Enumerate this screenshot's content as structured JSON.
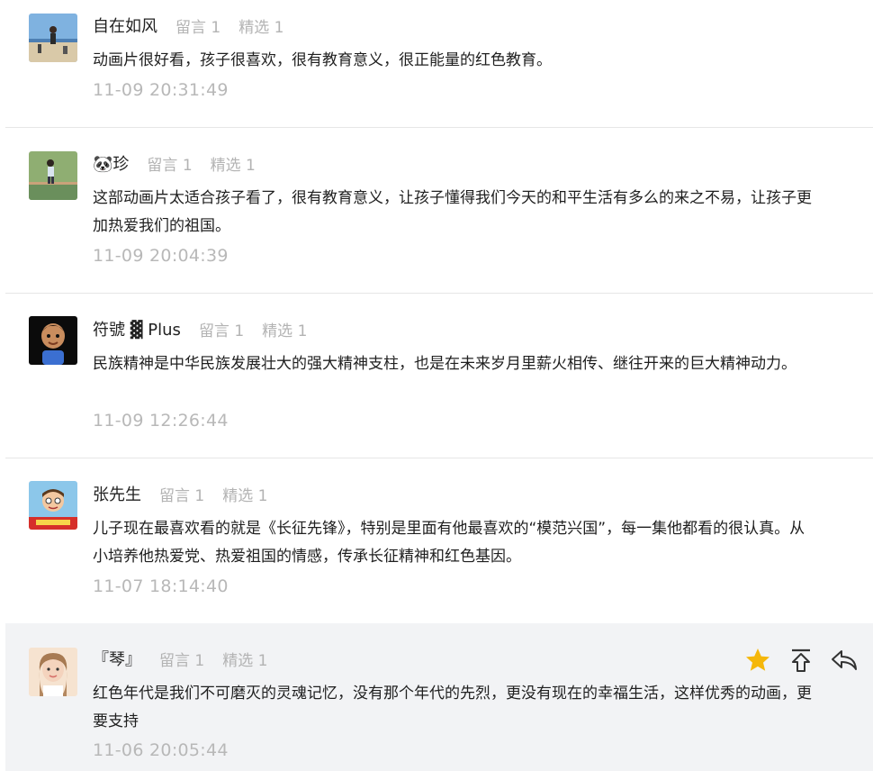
{
  "comments": [
    {
      "nickname": "自在如风",
      "reply_label": "留言 1",
      "select_label": "精选 1",
      "text": "动画片很好看，孩子很喜欢，很有教育意义，很正能量的红色教育。",
      "time": "11-09 20:31:49",
      "avatar_icon": "beach-photo-avatar"
    },
    {
      "nickname": "🐼珍",
      "reply_label": "留言 1",
      "select_label": "精选 1",
      "text": "这部动画片太适合孩子看了，很有教育意义，让孩子懂得我们今天的和平生活有多么的来之不易，让孩子更加热爱我们的祖国。",
      "time": "11-09 20:04:39",
      "avatar_icon": "park-photo-avatar"
    },
    {
      "nickname": "符號 ▓ Plus",
      "reply_label": "留言 1",
      "select_label": "精选 1",
      "text": "民族精神是中华民族发展壮大的强大精神支柱，也是在未来岁月里薪火相传、继往开来的巨大精神动力。",
      "time": "11-09 12:26:44",
      "avatar_icon": "cartoon-boy-avatar"
    },
    {
      "nickname": "张先生",
      "reply_label": "留言 1",
      "select_label": "精选 1",
      "text": "儿子现在最喜欢看的就是《长征先锋》，特别是里面有他最喜欢的“模范兴国”，每一集他都看的很认真。从小培养他热爱党、热爱祖国的情感，传承长征精神和红色基因。",
      "time": "11-07 18:14:40",
      "avatar_icon": "cartoon-kid-avatar"
    },
    {
      "nickname": "『琴』",
      "reply_label": "留言 1",
      "select_label": "精选 1",
      "text": "红色年代是我们不可磨灭的灵魂记忆，没有那个年代的先烈，更没有现在的幸福生活，这样优秀的动画，更要支持",
      "time": "11-06 20:05:44",
      "avatar_icon": "woman-photo-avatar"
    }
  ],
  "actions": {
    "star_icon": "star-icon",
    "pin_top_icon": "pin-top-icon",
    "reply_icon": "reply-icon",
    "star_color": "#f5b70a",
    "icon_color": "#333333"
  },
  "colors": {
    "highlight_bg": "#f2f3f5",
    "meta_gray": "#b3b3b3"
  }
}
